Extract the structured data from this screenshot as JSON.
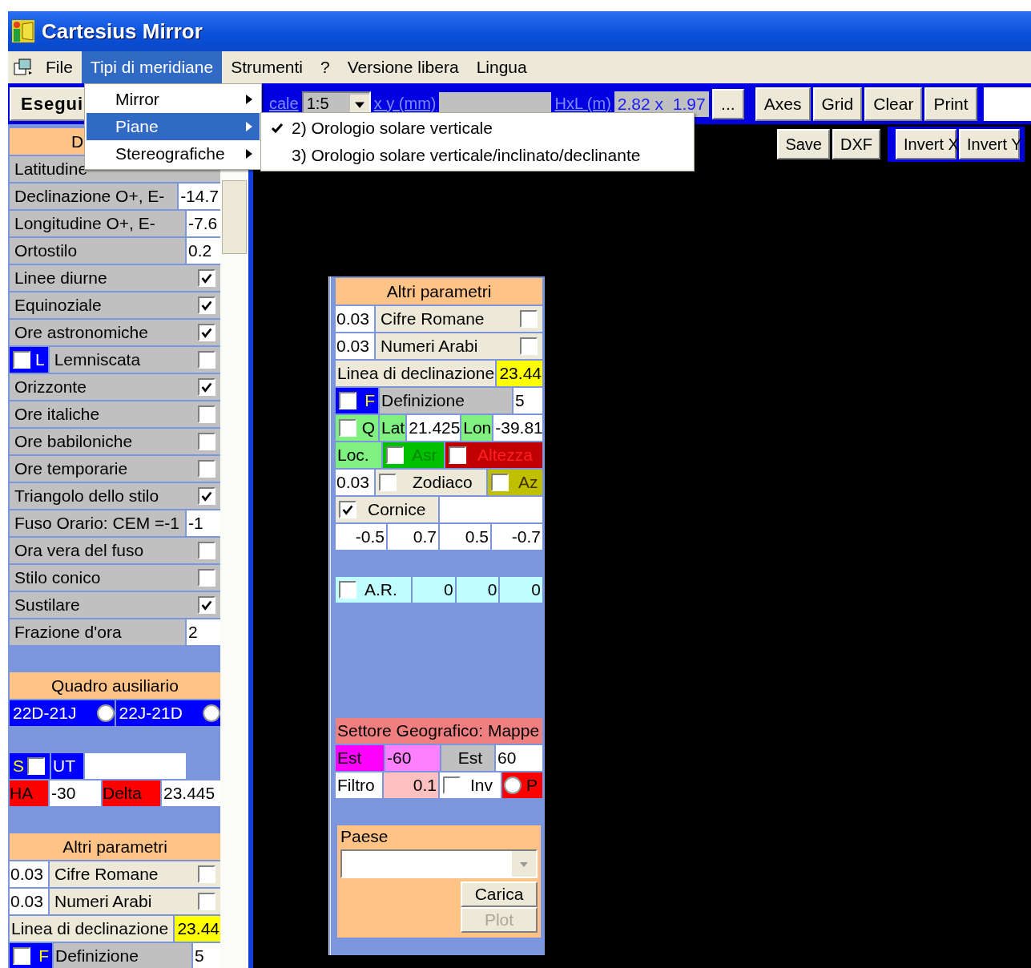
{
  "window": {
    "title": "Cartesius Mirror"
  },
  "menubar": [
    {
      "label": "File",
      "selected": false
    },
    {
      "label": "Tipi di meridiane",
      "selected": true
    },
    {
      "label": "Strumenti",
      "selected": false
    },
    {
      "label": "?",
      "selected": false
    },
    {
      "label": "Versione libera",
      "selected": false
    },
    {
      "label": "Lingua",
      "selected": false
    }
  ],
  "menu": {
    "items": [
      {
        "label": "Mirror",
        "selected": false
      },
      {
        "label": "Piane",
        "selected": true
      },
      {
        "label": "Stereografiche",
        "selected": false
      }
    ],
    "submenu": [
      {
        "label": "2) Orologio solare verticale",
        "checked": true
      },
      {
        "label": "3) Orologio solare verticale/inclinato/declinante",
        "checked": false
      }
    ]
  },
  "toolbar": {
    "run_button": "Esegui",
    "scale_label": "cale",
    "scale_value": "1:5",
    "xy_label": "x y (mm)",
    "size_label": "HxL (m)",
    "size_value": "2.82 x  1.97",
    "more_button": "...",
    "buttons": [
      "Axes",
      "Grid",
      "Clear",
      "Print"
    ]
  },
  "canvas_toolbar": {
    "file_buttons": [
      "Save",
      "DXF"
    ],
    "invert_buttons": [
      "Invert X",
      "Invert Y"
    ]
  },
  "sidebar": {
    "header": "D",
    "rows": [
      {
        "kind": "label",
        "label": "Latitudine"
      },
      {
        "kind": "input",
        "label": "Declinazione O+, E-",
        "value": "-14.7"
      },
      {
        "kind": "input",
        "label": "Longitudine O+, E-",
        "value": "-7.6"
      },
      {
        "kind": "input",
        "label": "Ortostilo",
        "value": "0.2"
      },
      {
        "kind": "check",
        "label": "Linee diurne",
        "checked": true
      },
      {
        "kind": "check",
        "label": "Equinoziale",
        "checked": true
      },
      {
        "kind": "check",
        "label": "Ore astronomiche",
        "checked": true
      },
      {
        "kind": "tagged_check",
        "tag": "L",
        "tag_checked": false,
        "label": "Lemniscata",
        "checked": false
      },
      {
        "kind": "check",
        "label": "Orizzonte",
        "checked": true
      },
      {
        "kind": "check",
        "label": "Ore italiche",
        "checked": false
      },
      {
        "kind": "check",
        "label": "Ore babiloniche",
        "checked": false
      },
      {
        "kind": "check",
        "label": "Ore temporarie",
        "checked": false
      },
      {
        "kind": "check",
        "label": "Triangolo dello stilo",
        "checked": true
      },
      {
        "kind": "input",
        "label": "Fuso Orario: CEM =-1",
        "value": "-1"
      },
      {
        "kind": "check",
        "label": "Ora vera del fuso",
        "checked": false
      },
      {
        "kind": "check",
        "label": "Stilo conico",
        "checked": false
      },
      {
        "kind": "check",
        "label": "Sustilare",
        "checked": true
      },
      {
        "kind": "input",
        "label": "Frazione d'ora",
        "value": "2"
      }
    ],
    "aux": {
      "header": "Quadro ausiliario",
      "options": [
        {
          "label": "22D-21J",
          "selected": false
        },
        {
          "label": "22J-21D",
          "selected": false
        }
      ]
    },
    "sun": {
      "s_label": "S",
      "s_checked": false,
      "ut_label": "UT",
      "ha_label": "HA",
      "ha_value": "-30",
      "delta_label": "Delta",
      "delta_value": "23.445"
    },
    "other": {
      "header": "Altri parametri",
      "roman": {
        "size": "0.03",
        "label": "Cifre Romane",
        "checked": false
      },
      "arabic": {
        "size": "0.03",
        "label": "Numeri Arabi",
        "checked": false
      },
      "declination_label": "Linea di declinazione",
      "declination_value": "23.44",
      "definition": {
        "tag": "F",
        "tag_checked": false,
        "label": "Definizione",
        "value": "5"
      }
    }
  },
  "params_panel": {
    "header": "Altri parametri",
    "roman": {
      "size": "0.03",
      "label": "Cifre Romane",
      "checked": false
    },
    "arabic": {
      "size": "0.03",
      "label": "Numeri Arabi",
      "checked": false
    },
    "declination_label": "Linea di declinazione",
    "declination_value": "23.44",
    "definition": {
      "tag": "F",
      "tag_checked": false,
      "label": "Definizione",
      "value": "5"
    },
    "location": {
      "tag": "Q",
      "tag_checked": false,
      "lat_label": "Lat",
      "lat_value": "21.425",
      "lon_label": "Lon",
      "lon_value": "-39.81"
    },
    "loc_label": "Loc.",
    "asr": {
      "label": "Asr",
      "checked": false
    },
    "altitude": {
      "label": "Altezza",
      "checked": false
    },
    "zodiac": {
      "size": "0.03",
      "label": "Zodiaco",
      "checked": false
    },
    "azimuth": {
      "label": "Az",
      "checked": false
    },
    "frame": {
      "label": "Cornice",
      "checked": true
    },
    "frame_values": [
      "-0.5",
      "0.7",
      "0.5",
      "-0.7"
    ],
    "ar": {
      "label": "A.R.",
      "checked": false,
      "values": [
        "0",
        "0",
        "0"
      ]
    },
    "sector": {
      "title": "Settore Geografico: Mappe",
      "east1_label": "Est",
      "east1_value": "-60",
      "east2_label": "Est",
      "east2_value": "60",
      "filter_label": "Filtro",
      "filter_value": "0.1",
      "inv_label": "Inv",
      "inv_checked": false,
      "p_label": "P",
      "p_selected": false
    },
    "town": {
      "label": "Paese",
      "load_button": "Carica",
      "plot_button": "Plot",
      "plot_disabled": true
    }
  }
}
